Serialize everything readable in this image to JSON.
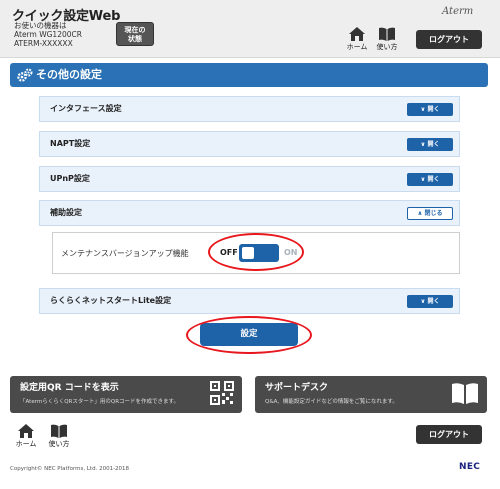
{
  "header": {
    "app_title": "クイック設定Web",
    "device_caption": "お使いの機器は",
    "device_model": "Aterm WG1200CR",
    "device_name": "ATERM-XXXXXX",
    "status_label_1": "現在の",
    "status_label_2": "状態",
    "brand": "Aterm",
    "home_label": "ホーム",
    "help_label": "使い方",
    "logout_label": "ログアウト"
  },
  "section": {
    "title": "その他の設定"
  },
  "accordion": [
    {
      "label": "インタフェース設定",
      "button": "開く"
    },
    {
      "label": "NAPT設定",
      "button": "開く"
    },
    {
      "label": "UPnP設定",
      "button": "開く"
    },
    {
      "label": "補助設定",
      "button": "閉じる"
    },
    {
      "label": "らくらくネットスタートLite設定",
      "button": "開く"
    }
  ],
  "maintenance": {
    "label": "メンテナンスバージョンアップ機能",
    "off_label": "OFF",
    "on_label": "ON",
    "value": "OFF"
  },
  "submit_label": "設定",
  "panels": {
    "qr": {
      "title": "設定用QR コードを表示",
      "desc": "「AtermらくらくQRスタート」用のQRコードを作成できます。"
    },
    "support": {
      "title": "サポートデスク",
      "desc": "Q&A、機能設定ガイドなどの情報をご覧になれます。"
    }
  },
  "footer": {
    "home_label": "ホーム",
    "help_label": "使い方",
    "logout_label": "ログアウト",
    "copyright": "Copyright© NEC Platforms, Ltd. 2001-2018",
    "logo": "NEC"
  },
  "colors": {
    "accent": "#2a72b5",
    "button": "#1e63a8",
    "highlight": "#e8171e"
  }
}
